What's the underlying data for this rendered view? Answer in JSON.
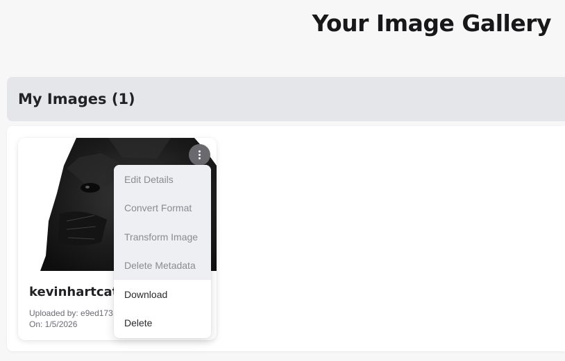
{
  "header": {
    "title": "Your Image Gallery"
  },
  "section": {
    "title": "My Images (1)"
  },
  "card": {
    "name": "kevinhartcat",
    "uploaded_by": "Uploaded by: e9ed173",
    "date": "On: 1/5/2026",
    "thumbnail_icon": "cat-photo"
  },
  "menu_button": {
    "icon": "vertical-dots-icon"
  },
  "context_menu": {
    "items": [
      {
        "label": "Edit Details",
        "state": "disabled"
      },
      {
        "label": "Convert Format",
        "state": "disabled"
      },
      {
        "label": "Transform Image",
        "state": "disabled"
      },
      {
        "label": "Delete Metadata",
        "state": "disabled"
      },
      {
        "label": "Download",
        "state": "enabled"
      },
      {
        "label": "Delete",
        "state": "enabled"
      }
    ]
  },
  "colors": {
    "page_bg": "#f7f7f8",
    "section_bg": "#e5e6ea",
    "menu_disabled_bg": "#eeeff3",
    "menu_button_bg": "#6a6a6e"
  }
}
